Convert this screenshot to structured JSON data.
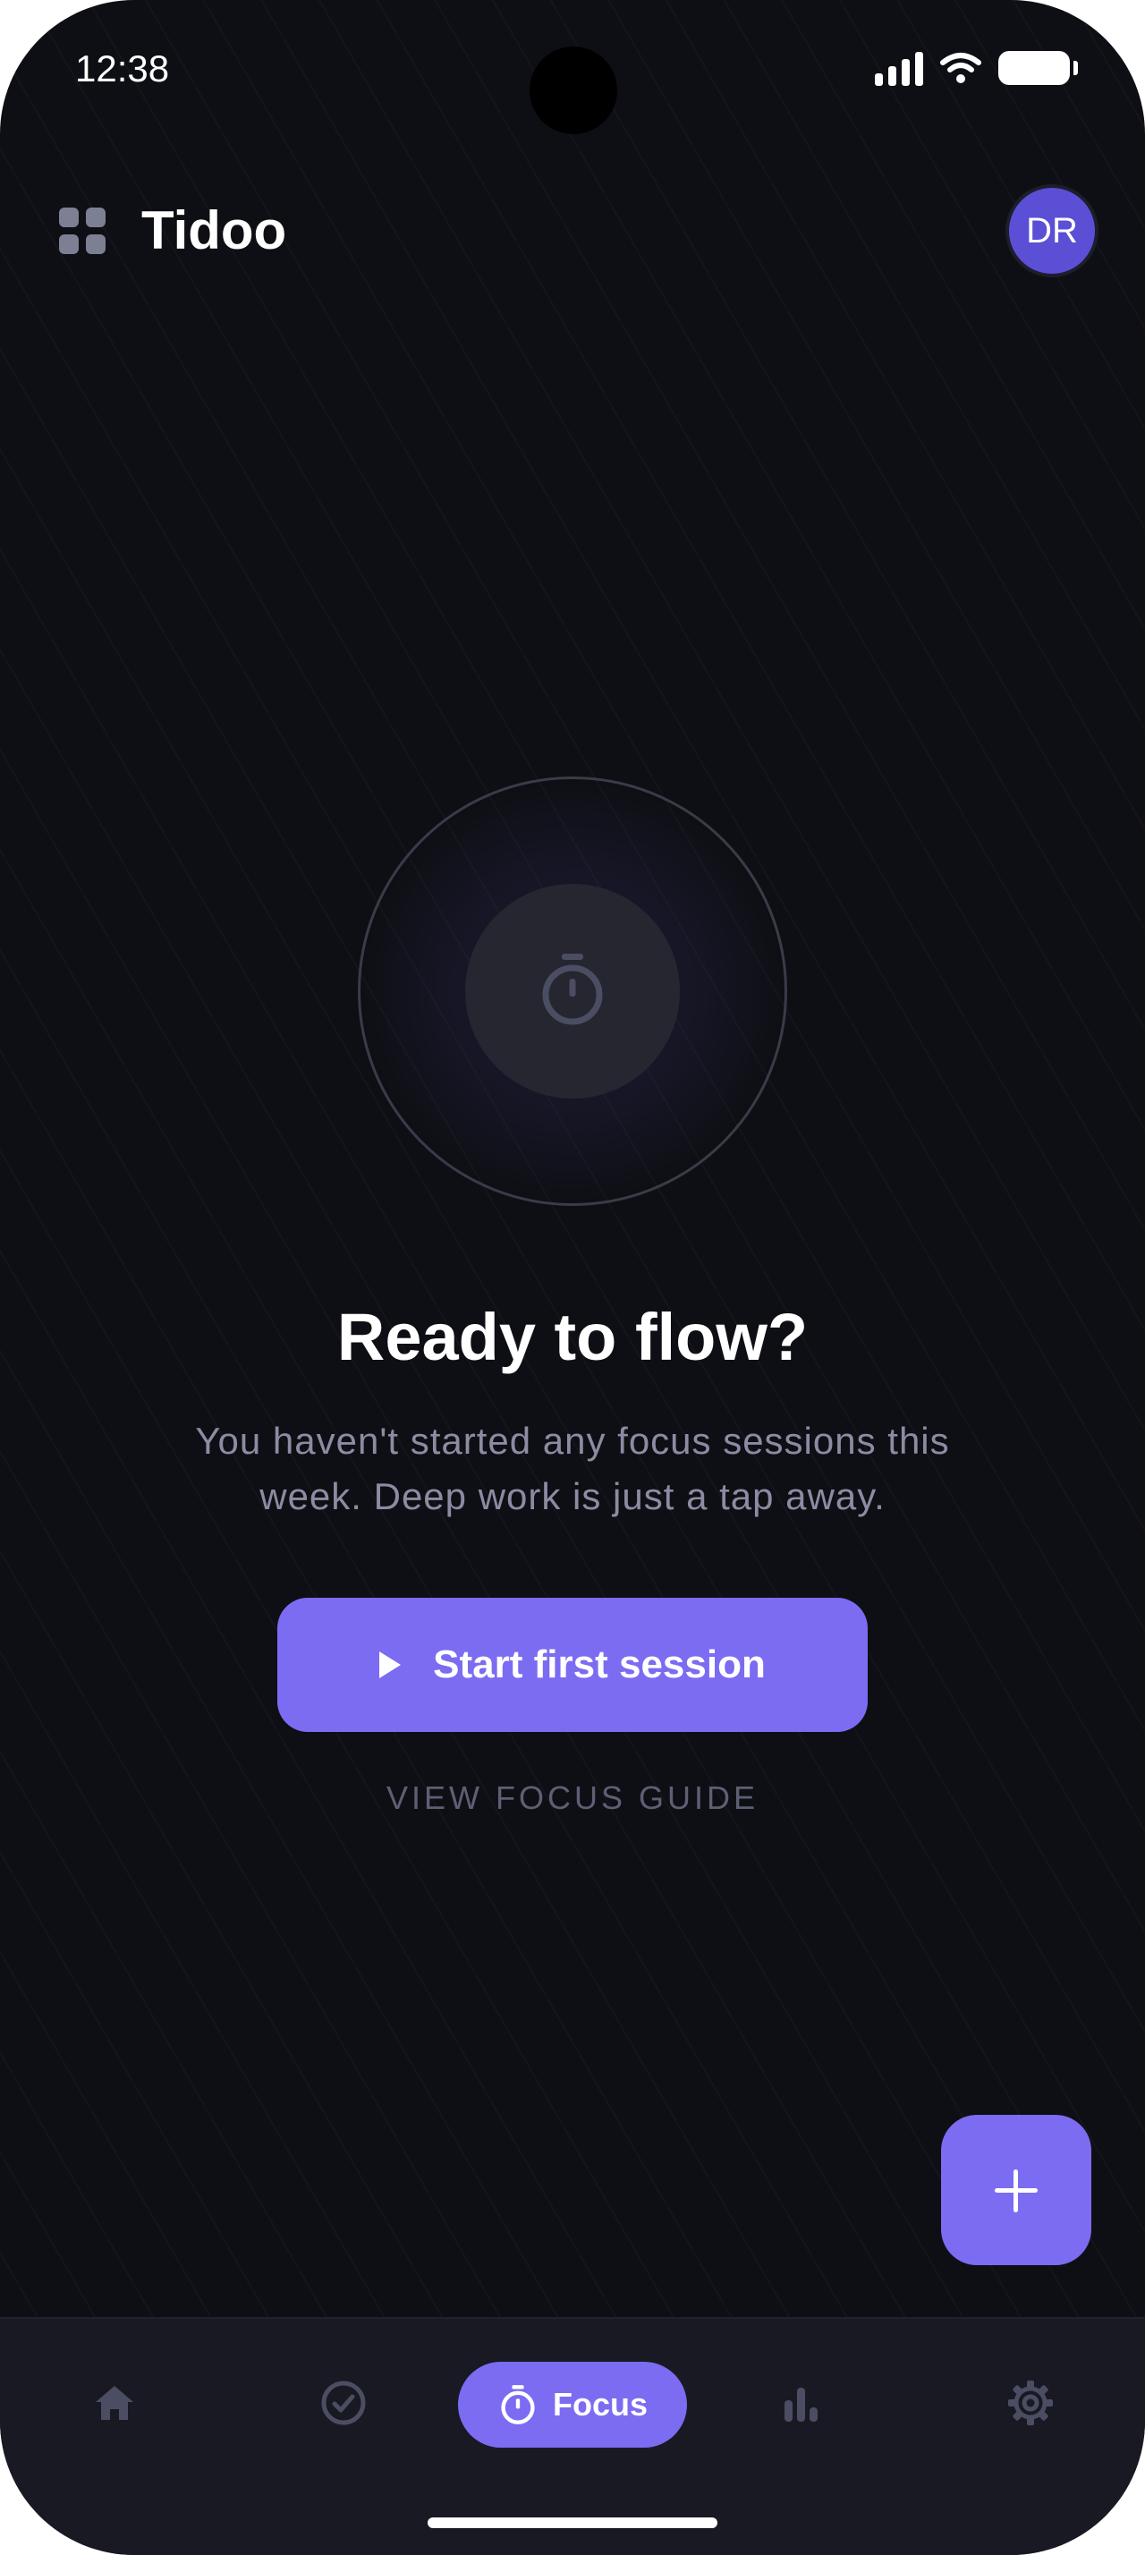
{
  "status_bar": {
    "time": "12:38"
  },
  "header": {
    "app_title": "Tidoo",
    "avatar_initials": "DR"
  },
  "empty_state": {
    "headline": "Ready to flow?",
    "description": "You haven't started any focus sessions this week. Deep work is just a tap away.",
    "primary_button": "Start first session",
    "secondary_link": "VIEW FOCUS GUIDE"
  },
  "bottom_nav": {
    "items": [
      {
        "id": "home",
        "icon": "home-icon"
      },
      {
        "id": "tasks",
        "icon": "check-circle-icon"
      },
      {
        "id": "focus",
        "icon": "timer-icon",
        "label": "Focus",
        "active": true
      },
      {
        "id": "stats",
        "icon": "bar-chart-icon"
      },
      {
        "id": "settings",
        "icon": "gear-icon"
      }
    ]
  },
  "colors": {
    "background": "#0e0f14",
    "accent": "#7b6cf2",
    "avatar": "#5b4fd6",
    "muted_text": "#8b8ca3",
    "nav_icon": "#4b4d62"
  }
}
